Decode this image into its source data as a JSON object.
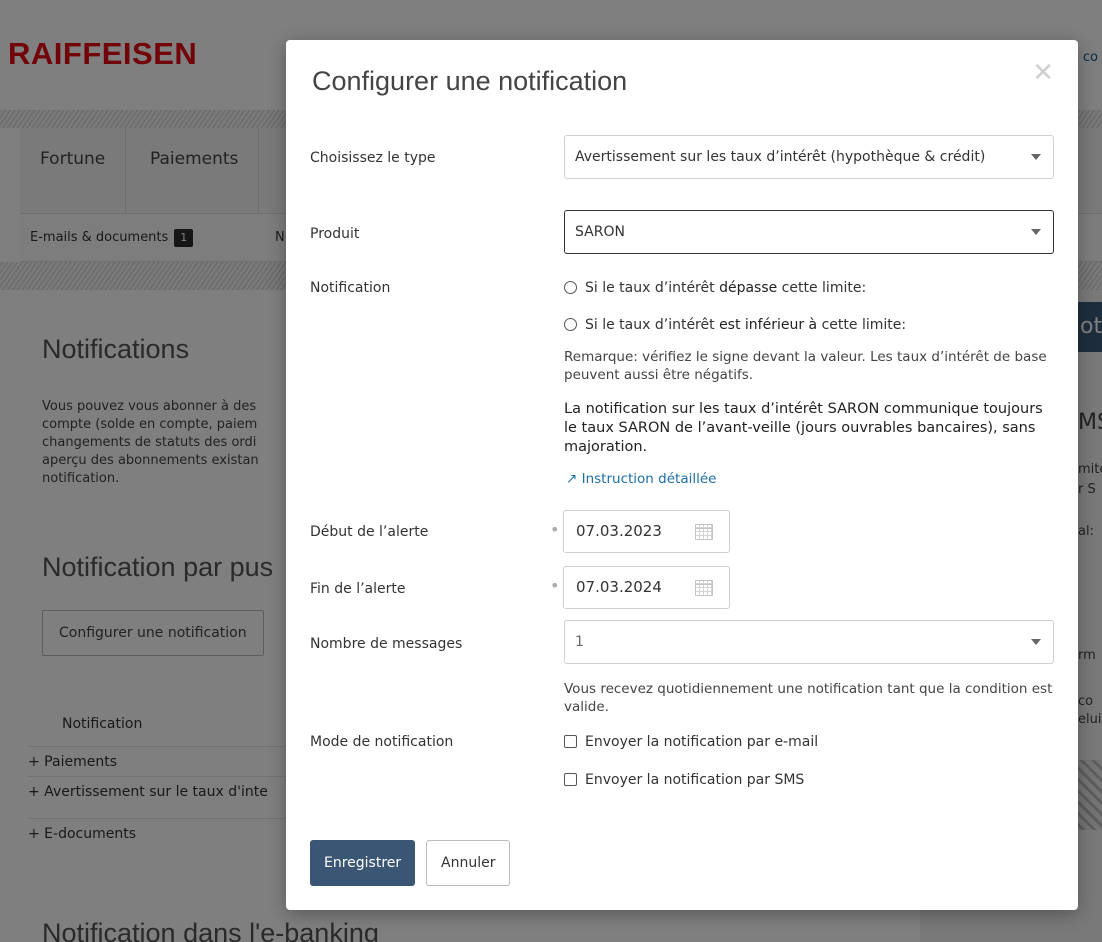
{
  "background": {
    "logo": "RAIFFEISEN",
    "top_right_fragment": "co",
    "main_nav": [
      "Fortune",
      "Paiements"
    ],
    "sub_nav": {
      "emails_docs": "E-mails & documents",
      "emails_badge": "1",
      "next_fragment": "N"
    },
    "heading_notifications": "Notifications",
    "intro_paragraph": "Vous pouvez vous abonner à des compte (solde en compte, paiem changements de statuts des ordi aperçu des abonnements existan notification.",
    "heading_push": "Notification par pus",
    "configure_button": "Configurer une notification",
    "table_header": "Notification",
    "table_rows": [
      "+ Paiements",
      "+ Avertissement sur le taux d'inte",
      "+ E-documents"
    ],
    "heading_ebanking": "Notification dans l'e-banking",
    "right_panel": {
      "blue_fragment": "oti",
      "sms_fragment": "MS",
      "frag1": "mite",
      "frag2": "r S",
      "frag3": "al:",
      "frag4": "rm",
      "frag5": "co",
      "frag6": "elui"
    }
  },
  "modal": {
    "title": "Configurer une notification",
    "close_icon": "close-icon",
    "type": {
      "label": "Choisissez le type",
      "value": "Avertissement sur les taux d’intérêt (hypothèque & crédit)"
    },
    "product": {
      "label": "Produit",
      "value": "SARON"
    },
    "notification": {
      "label": "Notification",
      "option_above_pre": "Si le taux d’intérêt ",
      "option_above_bold": "dépasse",
      "option_above_post": " cette limite:",
      "option_below_pre": "Si le taux d’intérêt ",
      "option_below_bold": "est inférieur à",
      "option_below_post": " cette limite:",
      "remark": "Remarque: vérifiez le signe devant la valeur. Les taux d’intérêt de base peuvent aussi être négatifs.",
      "saron_info": "La notification sur les taux d’intérêt SARON communique toujours le taux SARON de l’avant-veille (jours ouvrables bancaires), sans majoration.",
      "instruction_link": "↗ Instruction détaillée"
    },
    "start": {
      "label": "Début de l’alerte",
      "required_mark": "•",
      "value": "07.03.2023"
    },
    "end": {
      "label": "Fin de l’alerte",
      "required_mark": "•",
      "value": "07.03.2024"
    },
    "messages": {
      "label": "Nombre de messages",
      "value": "1",
      "hint": "Vous recevez quotidiennement une notification tant que la condition est valide."
    },
    "mode": {
      "label": "Mode de notification",
      "email": "Envoyer la notification par e-mail",
      "sms": "Envoyer la notification par SMS"
    },
    "save_button": "Enregistrer",
    "cancel_button": "Annuler"
  }
}
